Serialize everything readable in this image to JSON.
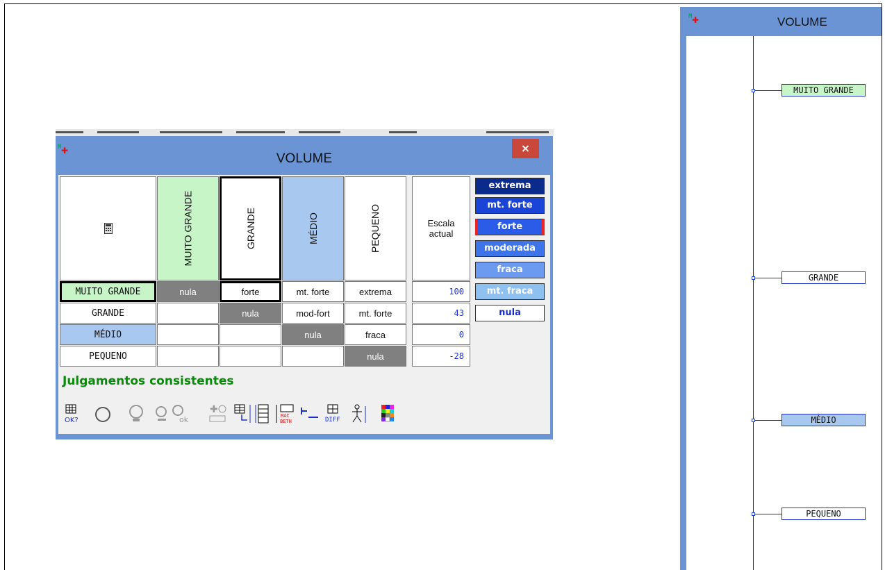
{
  "main_window": {
    "title": "VOLUME",
    "close_label": "×",
    "corner_icon": "calculator-icon",
    "columns": [
      "MUITO GRANDE",
      "GRANDE",
      "MÉDIO",
      "PEQUENO"
    ],
    "scale_header": "Escala actual",
    "rows": [
      {
        "label": "MUITO GRANDE",
        "cells": [
          "nula",
          "forte",
          "mt. forte",
          "extrema"
        ],
        "scale": "100"
      },
      {
        "label": "GRANDE",
        "cells": [
          "",
          "nula",
          "mod-fort",
          "mt. forte"
        ],
        "scale": "43"
      },
      {
        "label": "MÉDIO",
        "cells": [
          "",
          "",
          "nula",
          "fraca"
        ],
        "scale": "0"
      },
      {
        "label": "PEQUENO",
        "cells": [
          "",
          "",
          "",
          "nula"
        ],
        "scale": "-28"
      }
    ],
    "scale_levels": [
      {
        "label": "extrema",
        "color": "#0a2a8c"
      },
      {
        "label": "mt. forte",
        "color": "#1a44d8"
      },
      {
        "label": "forte",
        "color": "#2a5ce8"
      },
      {
        "label": "moderada",
        "color": "#3d74ea"
      },
      {
        "label": "fraca",
        "color": "#6c9af0"
      },
      {
        "label": "mt. fraca",
        "color": "#8ec0f0"
      },
      {
        "label": "nula",
        "color": "#ffffff"
      }
    ],
    "status": "Julgamentos consistentes",
    "toolbar": [
      {
        "icon": "consistency-check-icon",
        "label": "OK?"
      },
      {
        "icon": "refresh-icon",
        "label": ""
      },
      {
        "icon": "lightbulb-icon",
        "label": ""
      },
      {
        "icon": "lightbulb-small-icon",
        "label": ""
      },
      {
        "icon": "lightbulb-ok-icon",
        "label": "ok"
      },
      {
        "icon": "add-reference-icon",
        "label": ""
      },
      {
        "icon": "matrix-transpose-icon",
        "label": ""
      },
      {
        "icon": "thermometer-scale-icon",
        "label": ""
      },
      {
        "icon": "macbeth-icon",
        "label": "MAC BETH"
      },
      {
        "icon": "interval-icon",
        "label": ""
      },
      {
        "icon": "diff-icon",
        "label": "DIFF"
      },
      {
        "icon": "person-icon",
        "label": ""
      },
      {
        "icon": "color-palette-icon",
        "label": ""
      }
    ]
  },
  "side_window": {
    "title": "VOLUME",
    "nodes": [
      {
        "label": "MUITO GRANDE",
        "fill": "#c8f5c8"
      },
      {
        "label": "GRANDE",
        "fill": "#ffffff"
      },
      {
        "label": "MÉDIO",
        "fill": "#a8c8f0"
      },
      {
        "label": "PEQUENO",
        "fill": "#ffffff"
      }
    ]
  }
}
